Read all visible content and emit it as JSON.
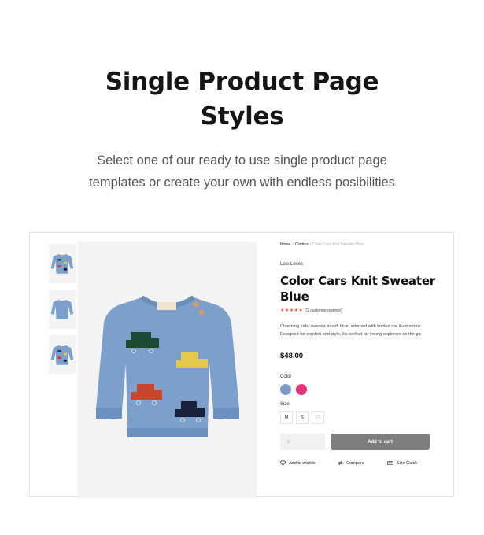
{
  "hero": {
    "title_line1": "Single Product Page",
    "title_line2": "Styles",
    "subtitle_line1": "Select one of our ready to use single product page",
    "subtitle_line2": "templates or create your own with endless posibilities"
  },
  "colors": {
    "sweater": "#7c9fcb",
    "swatch_blue": "#7b9ac4",
    "swatch_pink": "#e0357a",
    "star": "#e8573a",
    "button": "#7e7e7e"
  },
  "product": {
    "breadcrumb": [
      "Home",
      "Clothes",
      "Color Cars Knit Sweater Blue"
    ],
    "breadcrumb_sep": "/",
    "brand": "Lolo Loves",
    "title": "Color Cars Knit Sweater Blue",
    "stars": "★★★★★",
    "reviews": "(2 customer reviews)",
    "description": "Charming kids' sweater in soft blue, adorned with knitted car illustrations. Designed for comfort and style, it's perfect for young explorers on the go.",
    "price": "$48.00",
    "color_label": "Color",
    "size_label": "Size",
    "sizes": [
      "M",
      "S",
      "XS"
    ],
    "quantity": "1",
    "add_to_cart": "Add to cart",
    "actions": {
      "wishlist": "Add to wishlist",
      "compare": "Compare",
      "size_guide": "Size Guide"
    },
    "icons": [
      "heart-icon",
      "compare-icon",
      "size-guide-icon"
    ]
  }
}
